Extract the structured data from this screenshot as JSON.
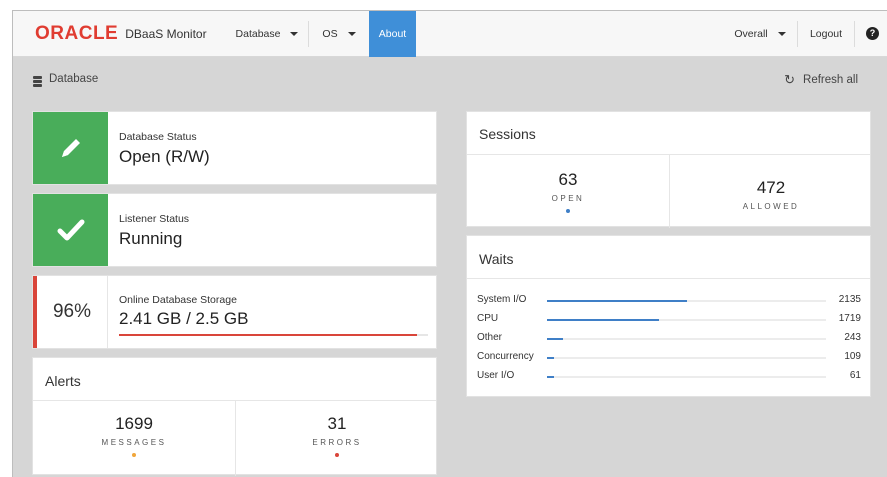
{
  "navbar": {
    "brand_logo": "ORACLE",
    "brand_name": "DBaaS Monitor",
    "items": [
      {
        "label": "Database",
        "has_caret": true
      },
      {
        "label": "OS",
        "has_caret": true
      },
      {
        "label": "About",
        "active": true
      }
    ],
    "right": {
      "overall": "Overall",
      "logout": "Logout",
      "help_icon": "question-circle-icon",
      "help_glyph": "?"
    },
    "active_color": "#3f8fd8",
    "brand_color": "#e03c31"
  },
  "subheader": {
    "title": "Database",
    "icon": "database-icon",
    "refresh_label": "Refresh all",
    "refresh_icon": "refresh-icon",
    "refresh_glyph": "↻"
  },
  "database_status": {
    "label": "Database Status",
    "value": "Open (R/W)",
    "icon": "pencil-icon",
    "color": "#49ad5a"
  },
  "listener_status": {
    "label": "Listener Status",
    "value": "Running",
    "icon": "check-icon",
    "color": "#49ad5a"
  },
  "storage": {
    "percent": "96%",
    "label": "Online Database Storage",
    "value": "2.41 GB / 2.5 GB",
    "fill_fraction": 0.964,
    "color": "#d9453a"
  },
  "alerts": {
    "title": "Alerts",
    "messages": {
      "count": "1699",
      "label": "MESSAGES",
      "dot_color": "#f0a63b"
    },
    "errors": {
      "count": "31",
      "label": "ERRORS",
      "dot_color": "#d9453a"
    }
  },
  "sessions": {
    "title": "Sessions",
    "open": {
      "count": "63",
      "label": "OPEN",
      "dot_color": "#3f7fc7"
    },
    "allowed": {
      "count": "472",
      "label": "ALLOWED"
    }
  },
  "waits": {
    "title": "Waits",
    "max": 2135,
    "rows": [
      {
        "label": "System I/O",
        "value": "2135",
        "n": 2135
      },
      {
        "label": "CPU",
        "value": "1719",
        "n": 1719
      },
      {
        "label": "Other",
        "value": "243",
        "n": 243
      },
      {
        "label": "Concurrency",
        "value": "109",
        "n": 109
      },
      {
        "label": "User I/O",
        "value": "61",
        "n": 61
      }
    ]
  }
}
